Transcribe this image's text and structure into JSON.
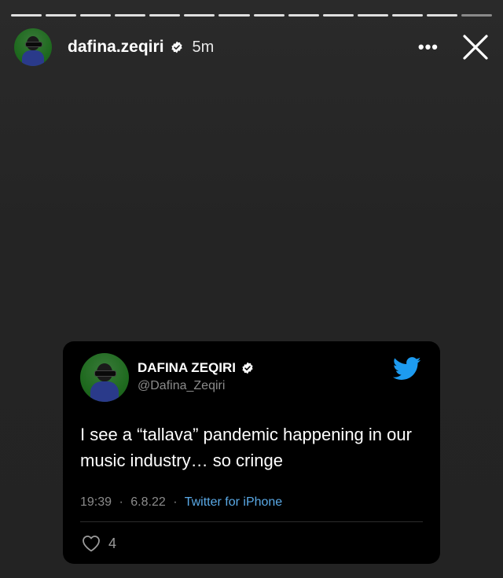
{
  "story": {
    "segments": 14,
    "username": "dafina.zeqiri",
    "time": "5m",
    "more_label": "•••"
  },
  "tweet": {
    "display_name": "DAFINA ZEQIRI",
    "handle": "@Dafina_Zeqiri",
    "text": "I see a “tallava” pandemic happening in our music industry… so cringe",
    "time": "19:39",
    "date": "6.8.22",
    "separator": "·",
    "source": "Twitter for iPhone",
    "likes": "4"
  },
  "colors": {
    "background": "#262626",
    "tweet_card": "#000000",
    "link_blue": "#5aa9e6",
    "twitter_blue": "#1d9bf0"
  },
  "icons": {
    "verified": "verified-badge-icon",
    "close": "close-icon",
    "more": "more-icon",
    "twitter": "twitter-bird-icon",
    "like": "heart-icon"
  }
}
